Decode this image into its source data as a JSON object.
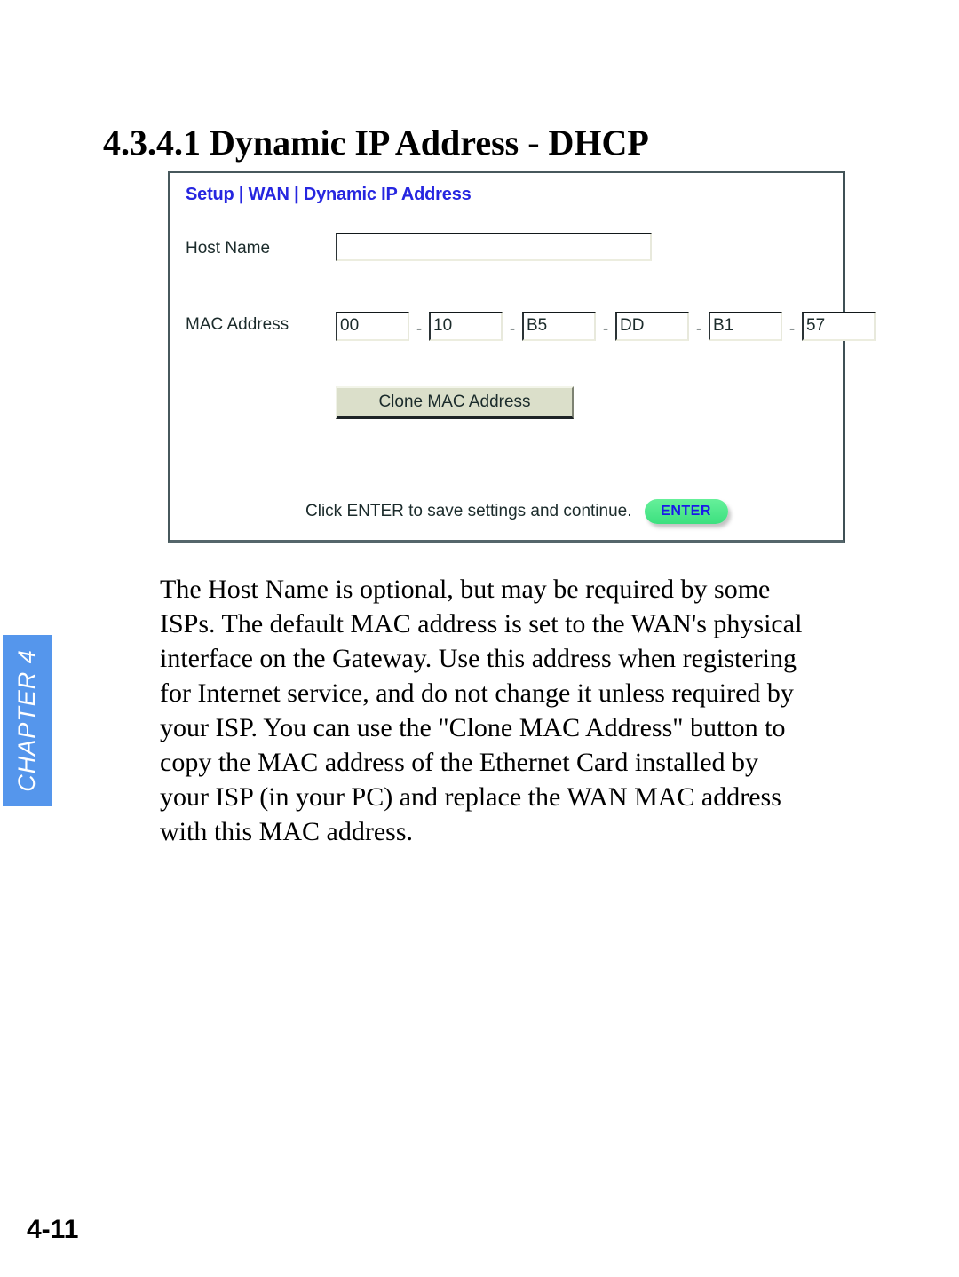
{
  "page": {
    "title": "4.3.4.1 Dynamic IP Address - DHCP",
    "number": "4-11",
    "chapter_tab": {
      "label": "CHAPTER 4",
      "color": "#5596ec",
      "text_color": "#ffffff"
    }
  },
  "screenshot_panel": {
    "heading": "Setup | WAN | Dynamic IP Address",
    "heading_color": "#2626e0",
    "fields": {
      "host_name": {
        "label": "Host Name",
        "value": "",
        "placeholder": ""
      },
      "mac_address": {
        "label": "MAC Address",
        "separator": "-",
        "octets": [
          "00",
          "10",
          "B5",
          "DD",
          "B1",
          "57"
        ]
      }
    },
    "clone_button": {
      "label": "Clone MAC Address",
      "background": "#dbdfca"
    },
    "footer": {
      "hint": "Click ENTER to save settings and continue.",
      "enter_button": {
        "label": "ENTER",
        "background": "#4ce68b",
        "text_color": "#1a1ae8"
      }
    }
  },
  "body": {
    "lines": [
      "The Host Name is optional, but may be required by some",
      "ISPs. The default MAC address is set to the WAN's physical",
      "interface on the Gateway. Use this address when registering",
      "for Internet service, and do not change it unless required by",
      "your ISP. You can use the \"Clone MAC Address\" button to",
      "copy the MAC address of the Ethernet Card installed by",
      "your ISP (in your PC) and replace the WAN MAC address",
      "with this MAC address."
    ]
  }
}
